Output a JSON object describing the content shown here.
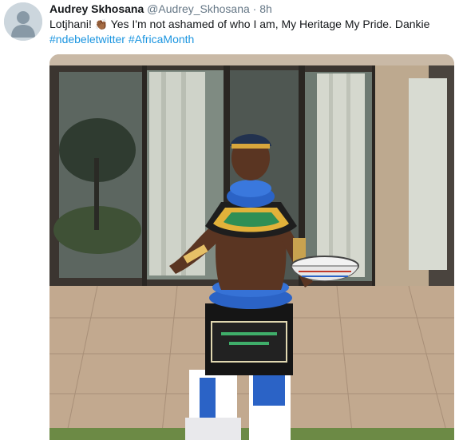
{
  "tweet": {
    "author_name": "Audrey Skhosana",
    "author_handle": "@Audrey_Skhosana",
    "separator": "·",
    "time": "8h",
    "text_part1": "Lotjhani!",
    "emoji": "👏🏾",
    "text_part2": "Yes I'm not ashamed of who I am, My Heritage My Pride. Dankie",
    "hashtags": [
      "#ndebeletwitter",
      "#AfricaMonth"
    ]
  },
  "colors": {
    "link": "#1b95e0",
    "secondary_text": "#657786",
    "primary_text": "#14171a"
  },
  "icons": {
    "avatar": "default-profile-icon"
  }
}
